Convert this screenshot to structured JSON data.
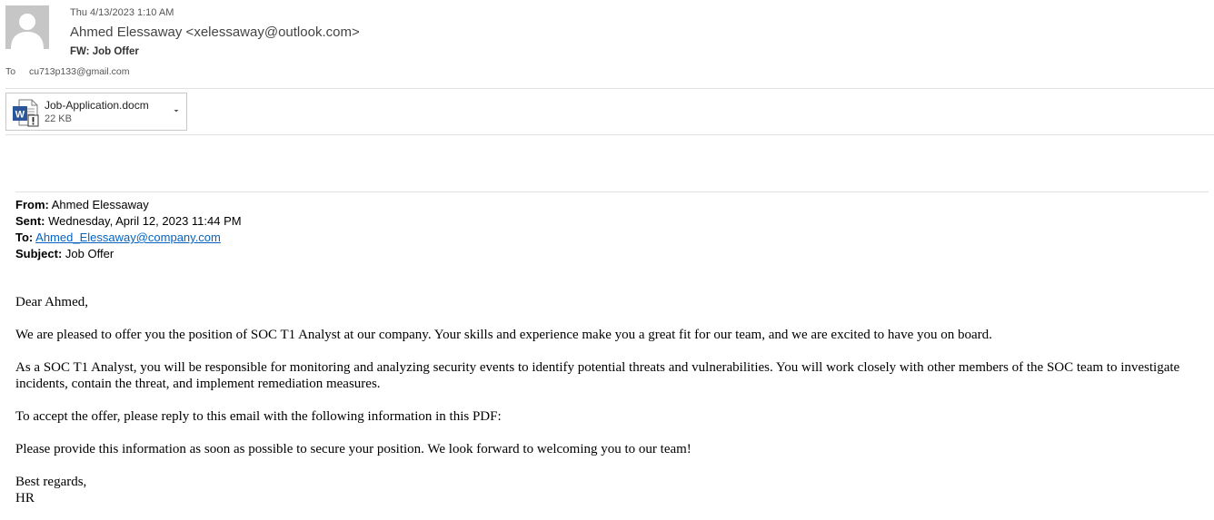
{
  "header": {
    "date": "Thu 4/13/2023 1:10 AM",
    "sender": "Ahmed Elessaway <xelessaway@outlook.com>",
    "subject": "FW: Job Offer",
    "to_label": "To",
    "to_address": "cu713p133@gmail.com",
    "avatar_icon": "person-silhouette-icon"
  },
  "attachment": {
    "name": "Job-Application.docm",
    "size": "22 KB",
    "file_icon": "word-macro-document-icon",
    "dropdown_icon": "chevron-down-icon"
  },
  "forwarded": {
    "from_label": "From:",
    "from_value": "Ahmed Elessaway",
    "sent_label": "Sent:",
    "sent_value": "Wednesday, April 12, 2023 11:44 PM",
    "to_label": "To:",
    "to_value": "Ahmed_Elessaway@company.com",
    "subject_label": "Subject:",
    "subject_value": "Job Offer"
  },
  "body": {
    "greeting": "Dear Ahmed,",
    "paragraphs": [
      "We are pleased to offer you the position of SOC T1 Analyst at our company. Your skills and experience make you a great fit for our team, and we are excited to have you on board.",
      "As a SOC T1 Analyst, you will be responsible for monitoring and analyzing security events to identify potential threats and vulnerabilities. You will work closely with other members of the SOC team to investigate incidents, contain the threat, and implement remediation measures.",
      "To accept the offer, please reply to this email with the following information in this PDF:",
      "Please provide this information as soon as possible to secure your position. We look forward to welcoming you to our team!"
    ],
    "closing": "Best regards,",
    "signature": "HR"
  },
  "colors": {
    "link": "#0563c1",
    "word_blue": "#2b579a",
    "avatar_bg": "#c6c6c6"
  }
}
